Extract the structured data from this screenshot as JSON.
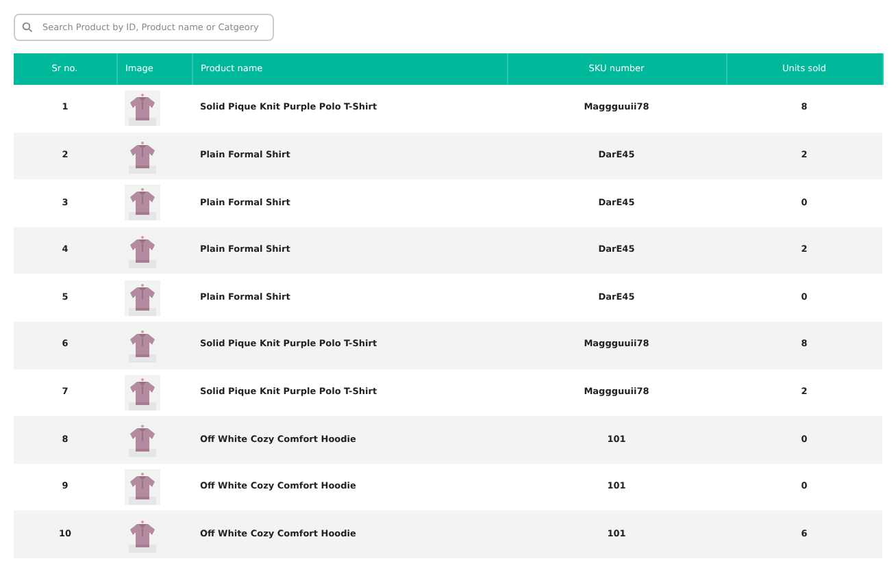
{
  "search": {
    "placeholder": "Search Product by ID, Product name or Catgeory"
  },
  "table": {
    "columns": [
      "Sr no.",
      "Image",
      "Product name",
      "SKU number",
      "Units sold"
    ],
    "rows": [
      {
        "sr": "1",
        "name": "Solid Pique Knit Purple Polo T-Shirt",
        "sku": "Maggguuii78",
        "units": "8"
      },
      {
        "sr": "2",
        "name": "Plain Formal Shirt",
        "sku": "DarE45",
        "units": "2"
      },
      {
        "sr": "3",
        "name": "Plain Formal Shirt",
        "sku": "DarE45",
        "units": "0"
      },
      {
        "sr": "4",
        "name": "Plain Formal Shirt",
        "sku": "DarE45",
        "units": "2"
      },
      {
        "sr": "5",
        "name": "Plain Formal Shirt",
        "sku": "DarE45",
        "units": "0"
      },
      {
        "sr": "6",
        "name": "Solid Pique Knit Purple Polo T-Shirt",
        "sku": "Maggguuii78",
        "units": "8"
      },
      {
        "sr": "7",
        "name": "Solid Pique Knit Purple Polo T-Shirt",
        "sku": "Maggguuii78",
        "units": "2"
      },
      {
        "sr": "8",
        "name": "Off White Cozy Comfort Hoodie",
        "sku": "101",
        "units": "0"
      },
      {
        "sr": "9",
        "name": "Off White Cozy Comfort Hoodie",
        "sku": "101",
        "units": "0"
      },
      {
        "sr": "10",
        "name": "Off White Cozy Comfort Hoodie",
        "sku": "101",
        "units": "6"
      }
    ]
  }
}
